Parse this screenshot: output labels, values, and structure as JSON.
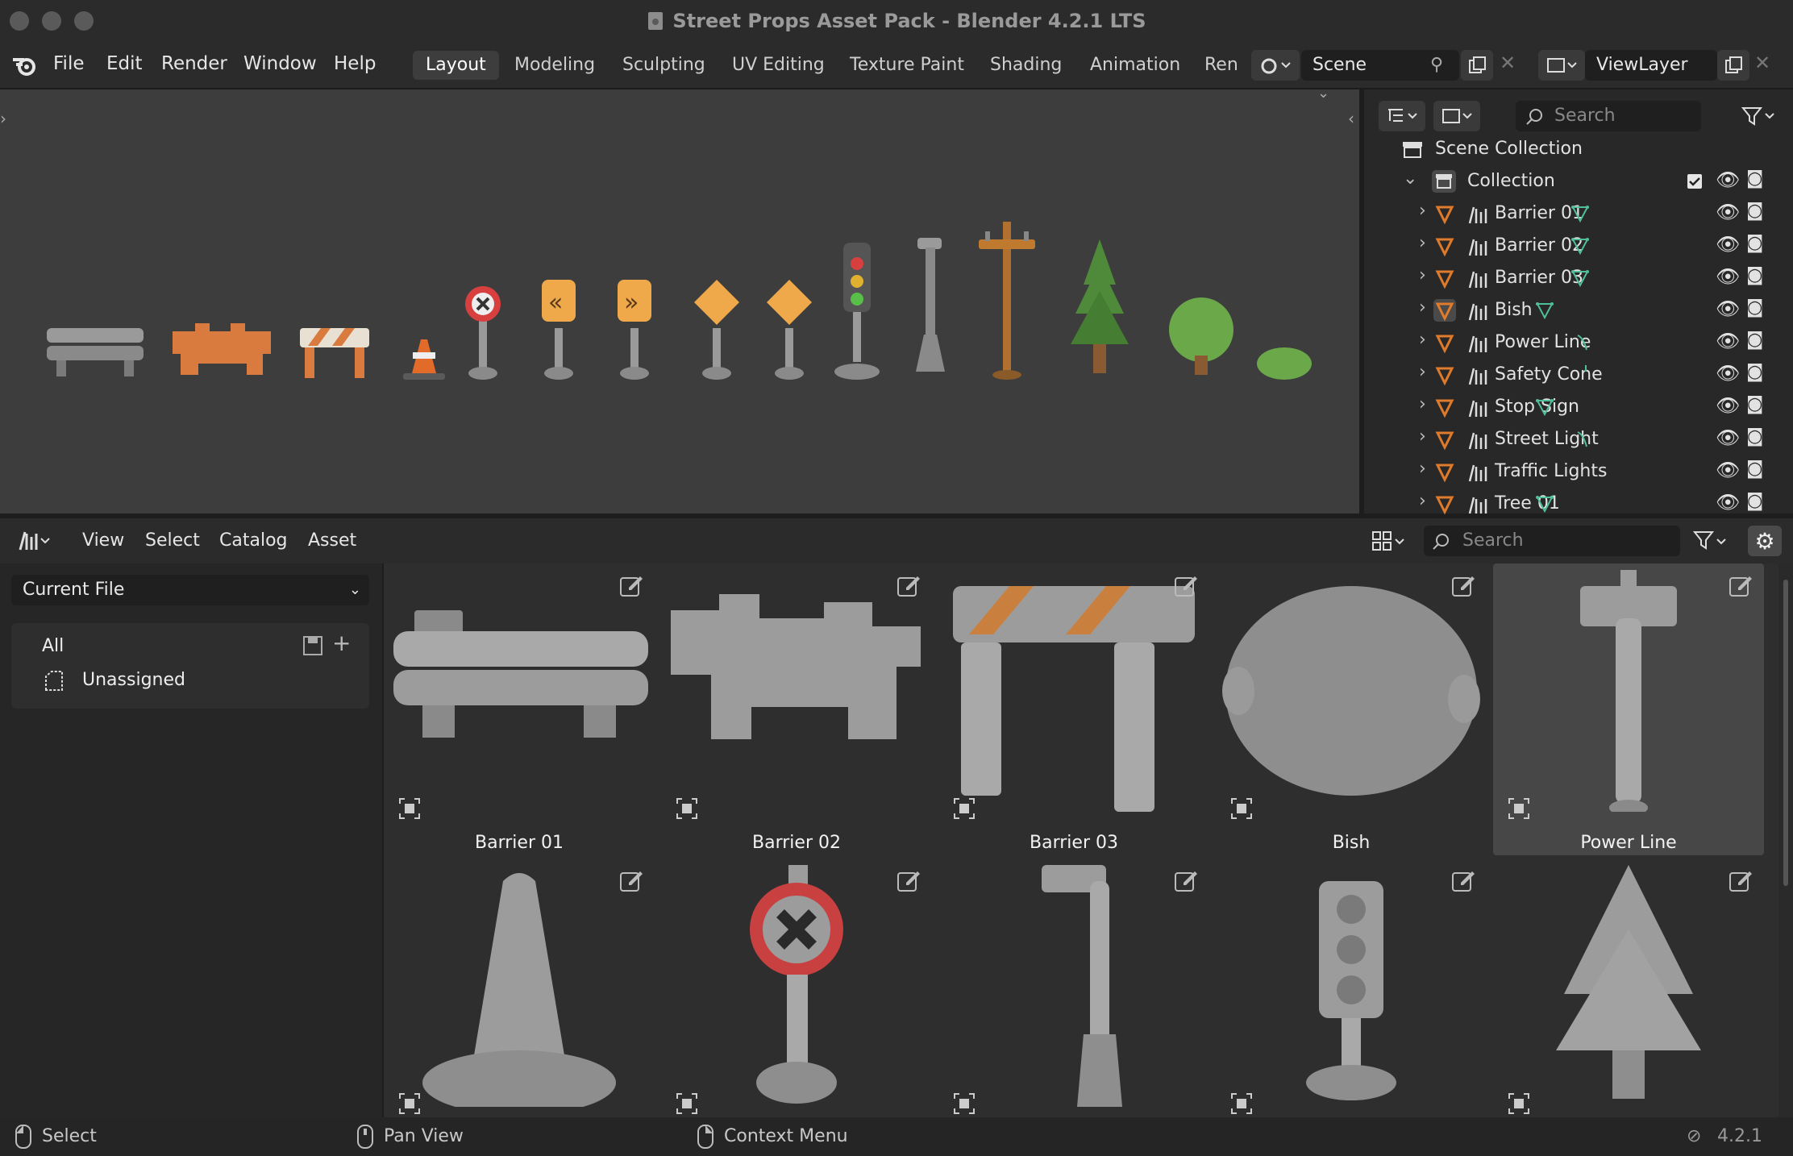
{
  "window": {
    "title": "Street Props Asset Pack - Blender 4.2.1 LTS"
  },
  "menus": [
    "File",
    "Edit",
    "Render",
    "Window",
    "Help"
  ],
  "workspaces": [
    "Layout",
    "Modeling",
    "Sculpting",
    "UV Editing",
    "Texture Paint",
    "Shading",
    "Animation",
    "Ren"
  ],
  "active_workspace": "Layout",
  "scene": {
    "name": "Scene",
    "view_layer": "ViewLayer"
  },
  "outliner": {
    "search_placeholder": "Search",
    "scene_collection": "Scene Collection",
    "collection": "Collection",
    "items": [
      "Barrier 01",
      "Barrier 02",
      "Barrier 03",
      "Bish",
      "Power Line",
      "Safety Cone",
      "Stop Sign",
      "Street Light",
      "Traffic Lights",
      "Tree 01"
    ]
  },
  "asset_browser": {
    "menus": [
      "View",
      "Select",
      "Catalog",
      "Asset"
    ],
    "library": "Current File",
    "catalogs": [
      "All",
      "Unassigned"
    ],
    "search_placeholder": "Search",
    "assets_row1": [
      "Barrier 01",
      "Barrier 02",
      "Barrier 03",
      "Bish",
      "Power Line"
    ],
    "assets_row2": [
      "Safety Cone",
      "Stop Sign",
      "Street Light",
      "Traffic Lights",
      "Tree 01"
    ],
    "selected_asset": "Power Line"
  },
  "status": {
    "select": "Select",
    "pan": "Pan View",
    "context": "Context Menu",
    "version": "4.2.1"
  },
  "colors": {
    "accent_orange": "#e07b2c",
    "ui_bg": "#2b2b2b",
    "viewport_bg": "#3d3d3d",
    "mesh_green": "#4fbf9a"
  }
}
